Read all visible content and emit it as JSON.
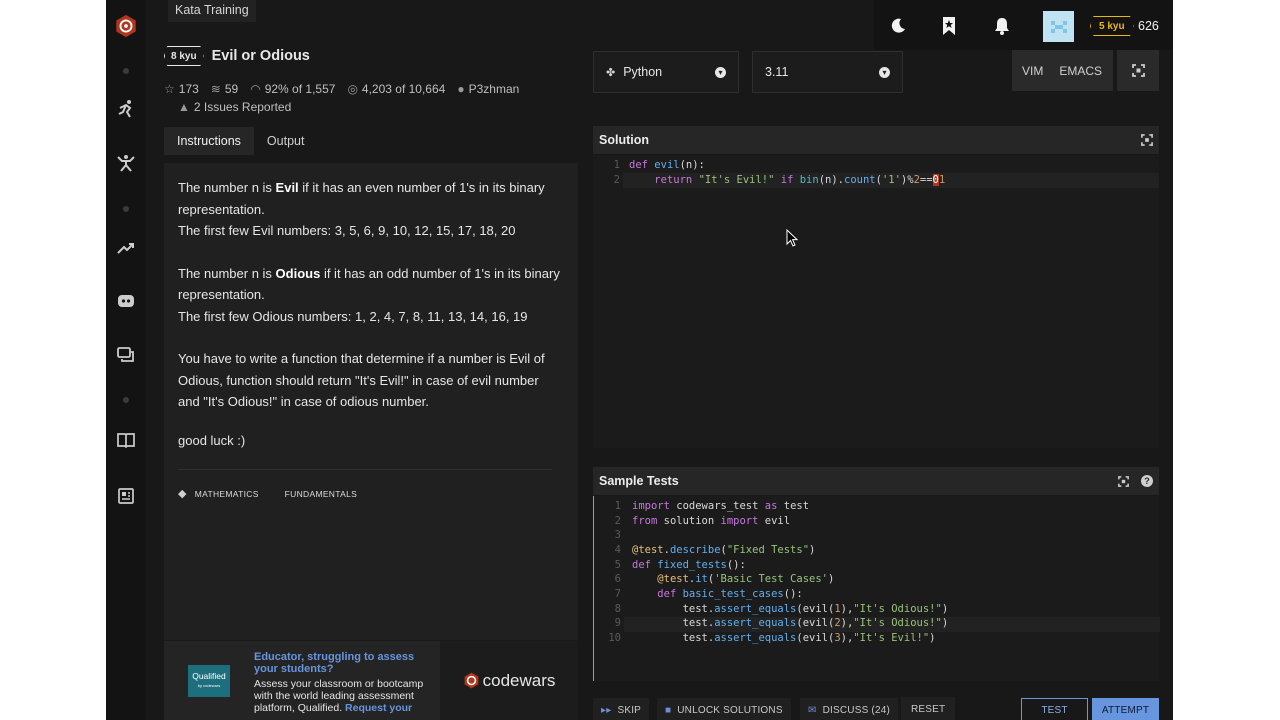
{
  "header": {
    "breadcrumb": "Kata Training"
  },
  "kata": {
    "rank": "8 kyu",
    "title": "Evil or Odious",
    "stats": {
      "stars": "173",
      "collections": "59",
      "satisfaction": "92% of 1,557",
      "completed": "4,203 of 10,664",
      "author": "P3zhman"
    },
    "issues": "2 Issues Reported"
  },
  "tabs": [
    {
      "label": "Instructions"
    },
    {
      "label": "Output"
    }
  ],
  "description": {
    "p1_pre": "The number n is ",
    "p1_bold": "Evil",
    "p1_post": " if it has an even number of 1's in its binary representation.",
    "p1_list": "The first few Evil numbers: 3, 5, 6, 9, 10, 12, 15, 17, 18, 20",
    "p2_pre": "The number n is ",
    "p2_bold": "Odious",
    "p2_post": " if it has an odd number of 1's in its binary representation.",
    "p2_list": "The first few Odious numbers: 1, 2, 4, 7, 8, 11, 13, 14, 16, 19",
    "p3": "You have to write a function that determine if a number is Evil of Odious, function should return \"It's Evil!\" in case of evil number and \"It's Odious!\" in case of odious number.",
    "p4": "good luck :)"
  },
  "tags": [
    "MATHEMATICS",
    "FUNDAMENTALS"
  ],
  "promo": {
    "logo": "Qualified",
    "logo_sub": "by codewars",
    "headline": "Educator, struggling to assess your students?",
    "body": "Assess your classroom or bootcamp with the world leading assessment platform, Qualified.",
    "link": "Request your",
    "brand": "codewars"
  },
  "editor": {
    "language": "Python",
    "version": "3.11",
    "vim": "VIM",
    "emacs": "EMACS",
    "solution_title": "Solution",
    "tests_title": "Sample Tests"
  },
  "user": {
    "rank": "5 kyu",
    "honor": "626"
  },
  "bottom": {
    "skip": "SKIP",
    "unlock": "UNLOCK SOLUTIONS",
    "discuss": "DISCUSS (24)",
    "reset": "RESET",
    "test": "TEST",
    "attempt": "ATTEMPT"
  },
  "colors": {
    "accent": "#b1361e",
    "rank_yellow": "#ecb613",
    "attempt_blue": "#6795de",
    "link": "#6795de"
  },
  "icons": [
    "codewars-logo-icon",
    "dojo-icon",
    "kata-icon",
    "trending-icon",
    "discord-icon",
    "chat-icon",
    "book-icon",
    "news-icon",
    "moon-icon",
    "bookmark-icon",
    "bell-icon",
    "avatar"
  ]
}
